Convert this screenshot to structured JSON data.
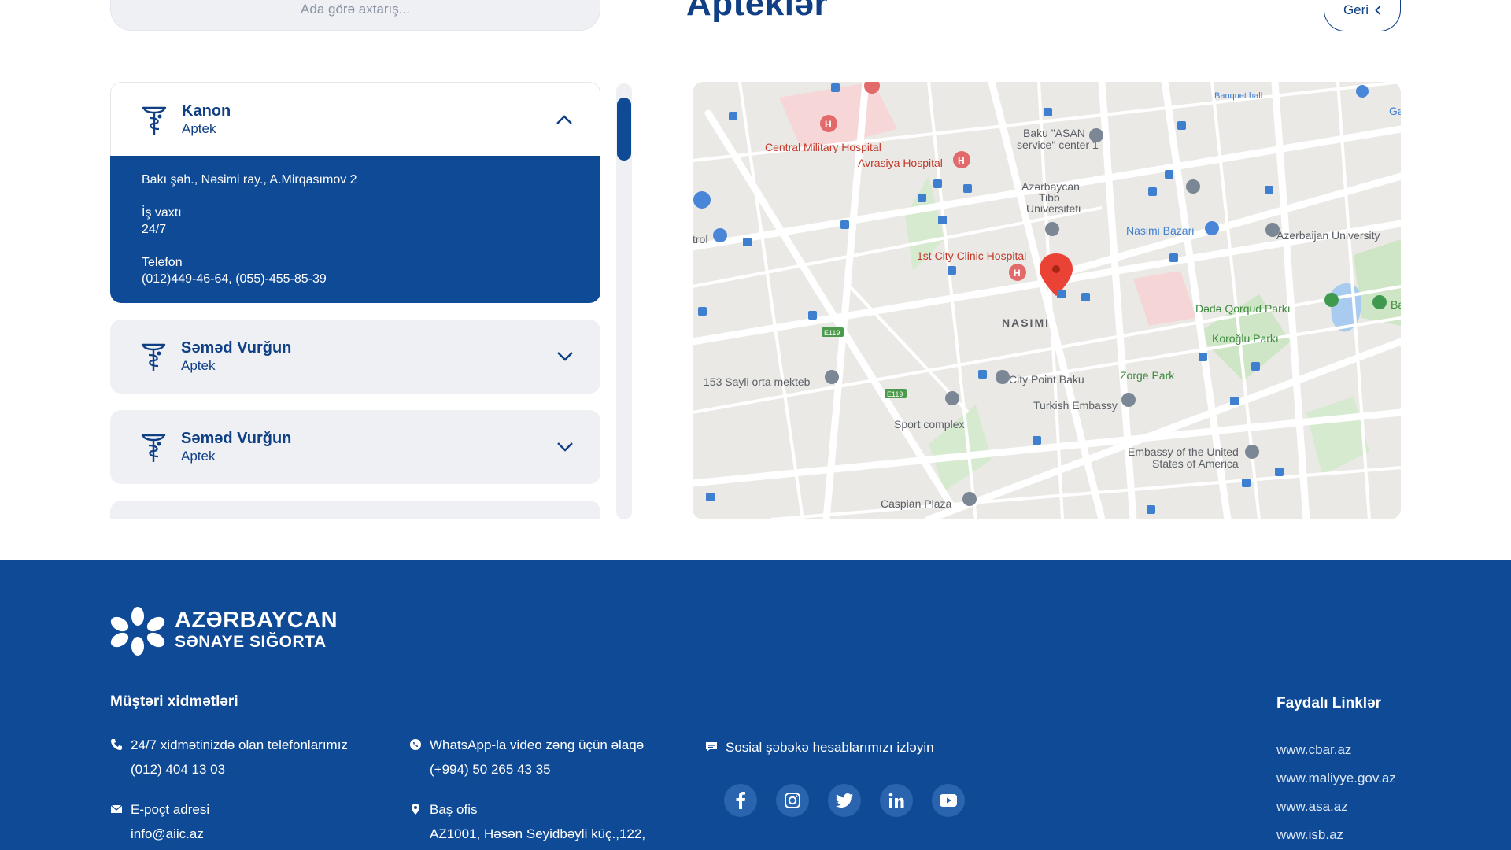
{
  "search": {
    "placeholder": "Ada görə axtarış..."
  },
  "page_title": "Apteklər",
  "back_label": "Geri",
  "pharmacies": [
    {
      "name": "Kanon",
      "type": "Aptek",
      "expanded": true,
      "address": "Bakı şəh., Nəsimi ray., A.Mirqasımov 2",
      "hours_label": "İş vaxtı",
      "hours": "24/7",
      "phone_label": "Telefon",
      "phone": "(012)449-46-64, (055)-455-85-39"
    },
    {
      "name": "Səməd Vurğun",
      "type": "Aptek",
      "expanded": false
    },
    {
      "name": "Səməd Vurğun",
      "type": "Aptek",
      "expanded": false
    }
  ],
  "map": {
    "labels": {
      "central_military": "Central Military Hospital",
      "avrasiya": "Avrasiya Hospital",
      "asan": "Baku \"ASAN",
      "asan2": "service\" center 1",
      "tibb1": "Azərbaycan",
      "tibb2": "Tibb",
      "tibb3": "Universiteti",
      "nasimi_bazari": "Nasimi Bazari",
      "az_univ": "Azerbaijan University",
      "clinic": "1st City Clinic Hospital",
      "nasimi": "NASIMI",
      "dede": "Dədə Qorqud Parkı",
      "koroglu": "Koroğlu Parkı",
      "zorge": "Zorge Park",
      "city_point": "City Point Baku",
      "turkish": "Turkish Embassy",
      "school": "153 Sayli orta mektеb",
      "sport": "Sport complex",
      "embassy_us1": "Embassy of the United",
      "embassy_us2": "States of America",
      "caspian": "Caspian Plaza",
      "banquet": "Banquet hall",
      "trol": "trol",
      "e119a": "E119",
      "e119b": "E119",
      "ga": "Ga",
      "ba": "Ba"
    }
  },
  "footer": {
    "logo_line1": "AZƏRBAYCAN",
    "logo_line2": "SƏNAYE SIĞORTA",
    "customer_services": "Müştəri xidmətləri",
    "useful_links": "Faydalı Linklər",
    "phone_label": "24/7 xidmətinizdə olan telefonlarımız",
    "phone_value": "(012) 404 13 03",
    "whatsapp_label": "WhatsApp-la video zəng üçün əlaqə",
    "whatsapp_value": "(+994) 50 265 43 35",
    "social_label": "Sosial şəbəkə hesablarımızı izləyin",
    "email_label": "E-poçt adresi",
    "email_value": "info@aiic.az",
    "office_label": "Baş ofis",
    "office_value": "AZ1001, Həsən Seyidbəyli küç.,122,",
    "links": [
      "www.cbar.az",
      "www.maliyye.gov.az",
      "www.asa.az",
      "www.isb.az"
    ],
    "social_icons": [
      "f",
      "ig",
      "tw",
      "in",
      "yt"
    ]
  }
}
